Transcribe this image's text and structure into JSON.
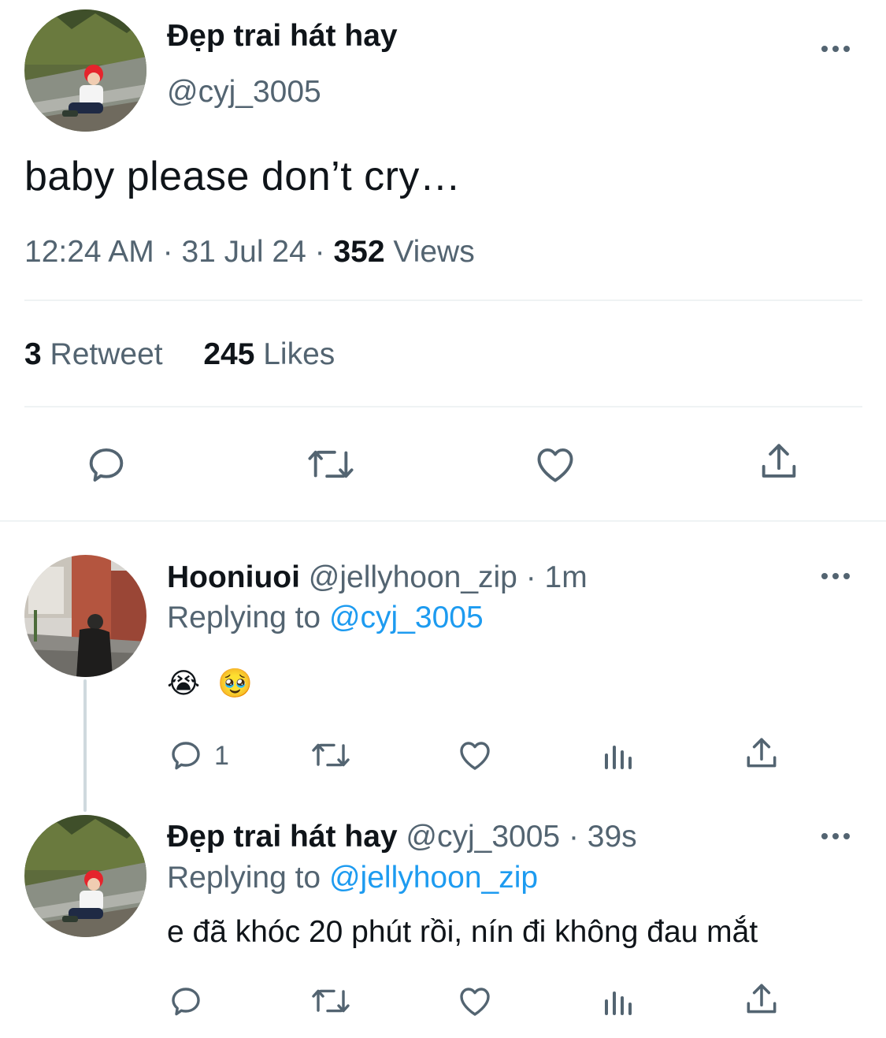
{
  "main_tweet": {
    "author_name": "Đẹp trai hát hay",
    "author_handle": "@cyj_3005",
    "text": "baby please don’t cry…",
    "time": "12:24 AM",
    "date": "31 Jul 24",
    "separator": "·",
    "views_count": "352",
    "views_label": "Views",
    "retweets_count": "3",
    "retweets_label": "Retweet",
    "likes_count": "245",
    "likes_label": "Likes"
  },
  "replies": [
    {
      "author_name": "Hooniuoi",
      "author_handle": "@jellyhoon_zip",
      "meta": "· 1m",
      "replying_prefix": "Replying to",
      "replying_to": "@cyj_3005",
      "text": "😭 🥹",
      "reply_count": "1"
    },
    {
      "author_name": "Đẹp trai hát hay",
      "author_handle": "@cyj_3005",
      "meta": "· 39s",
      "replying_prefix": "Replying to",
      "replying_to": "@jellyhoon_zip",
      "text": "e đã khóc 20 phút rồi, nín đi không đau mắt",
      "reply_count": ""
    }
  ],
  "icons": [
    "more-icon",
    "reply-icon",
    "retweet-icon",
    "like-icon",
    "share-icon",
    "views-icon"
  ],
  "colors": {
    "text": "#0f1419",
    "muted": "#536471",
    "link": "#1d9bf0",
    "divider": "#eff3f4"
  }
}
